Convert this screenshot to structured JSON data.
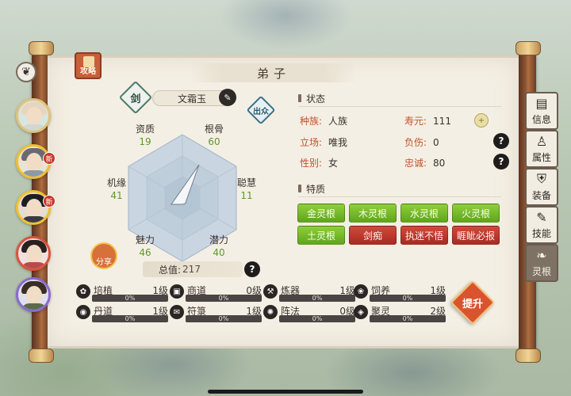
{
  "header": {
    "title": "弟子",
    "guide_label": "攻略"
  },
  "character": {
    "class_badge": "剑",
    "name": "文霜玉",
    "out_label": "出众",
    "share_label": "分享",
    "total_label": "总值:",
    "total_value": "217",
    "stats": {
      "qualification": {
        "label": "资质",
        "value": "19"
      },
      "bone": {
        "label": "根骨",
        "value": "60"
      },
      "luck": {
        "label": "机缘",
        "value": "41"
      },
      "wisdom": {
        "label": "聪慧",
        "value": "11"
      },
      "charm": {
        "label": "魅力",
        "value": "46"
      },
      "potential": {
        "label": "潜力",
        "value": "40"
      }
    }
  },
  "status": {
    "title": "状态",
    "race_label": "种族:",
    "race_value": "人族",
    "lifespan_label": "寿元:",
    "lifespan_value": "111",
    "stance_label": "立场:",
    "stance_value": "唯我",
    "injury_label": "负伤:",
    "injury_value": "0",
    "gender_label": "性别:",
    "gender_value": "女",
    "loyalty_label": "忠诚:",
    "loyalty_value": "80"
  },
  "traits": {
    "title": "特质",
    "items": [
      {
        "label": "金灵根",
        "tone": "green"
      },
      {
        "label": "木灵根",
        "tone": "green"
      },
      {
        "label": "水灵根",
        "tone": "green"
      },
      {
        "label": "火灵根",
        "tone": "green"
      },
      {
        "label": "土灵根",
        "tone": "green"
      },
      {
        "label": "剑痴",
        "tone": "red"
      },
      {
        "label": "执迷不悟",
        "tone": "red"
      },
      {
        "label": "睚眦必报",
        "tone": "red"
      }
    ]
  },
  "skills": [
    {
      "name": "培植",
      "level": "1级",
      "pct": "0%",
      "icon": "seedling-icon"
    },
    {
      "name": "商道",
      "level": "0级",
      "pct": "0%",
      "icon": "ledger-icon"
    },
    {
      "name": "炼器",
      "level": "1级",
      "pct": "0%",
      "icon": "forge-icon"
    },
    {
      "name": "饲养",
      "level": "1级",
      "pct": "0%",
      "icon": "paw-icon"
    },
    {
      "name": "丹道",
      "level": "1级",
      "pct": "0%",
      "icon": "pill-icon"
    },
    {
      "name": "符箓",
      "level": "1级",
      "pct": "0%",
      "icon": "talisman-icon"
    },
    {
      "name": "阵法",
      "level": "0级",
      "pct": "0%",
      "icon": "formation-icon"
    },
    {
      "name": "聚灵",
      "level": "2级",
      "pct": "0%",
      "icon": "spirit-icon"
    }
  ],
  "upgrade_label": "提升",
  "tabs": [
    {
      "label": "信息",
      "icon": "book-icon"
    },
    {
      "label": "属性",
      "icon": "meditate-icon"
    },
    {
      "label": "装备",
      "icon": "armor-icon"
    },
    {
      "label": "技能",
      "icon": "scroll-icon"
    },
    {
      "label": "灵根",
      "icon": "root-icon"
    }
  ],
  "avatar_badges": {
    "new": "新"
  },
  "help_label": "?",
  "colors": {
    "accent_orange": "#d9542e",
    "stat_green": "#5c9a2a",
    "trait_green": "#6fb826",
    "trait_red": "#b8322a"
  }
}
